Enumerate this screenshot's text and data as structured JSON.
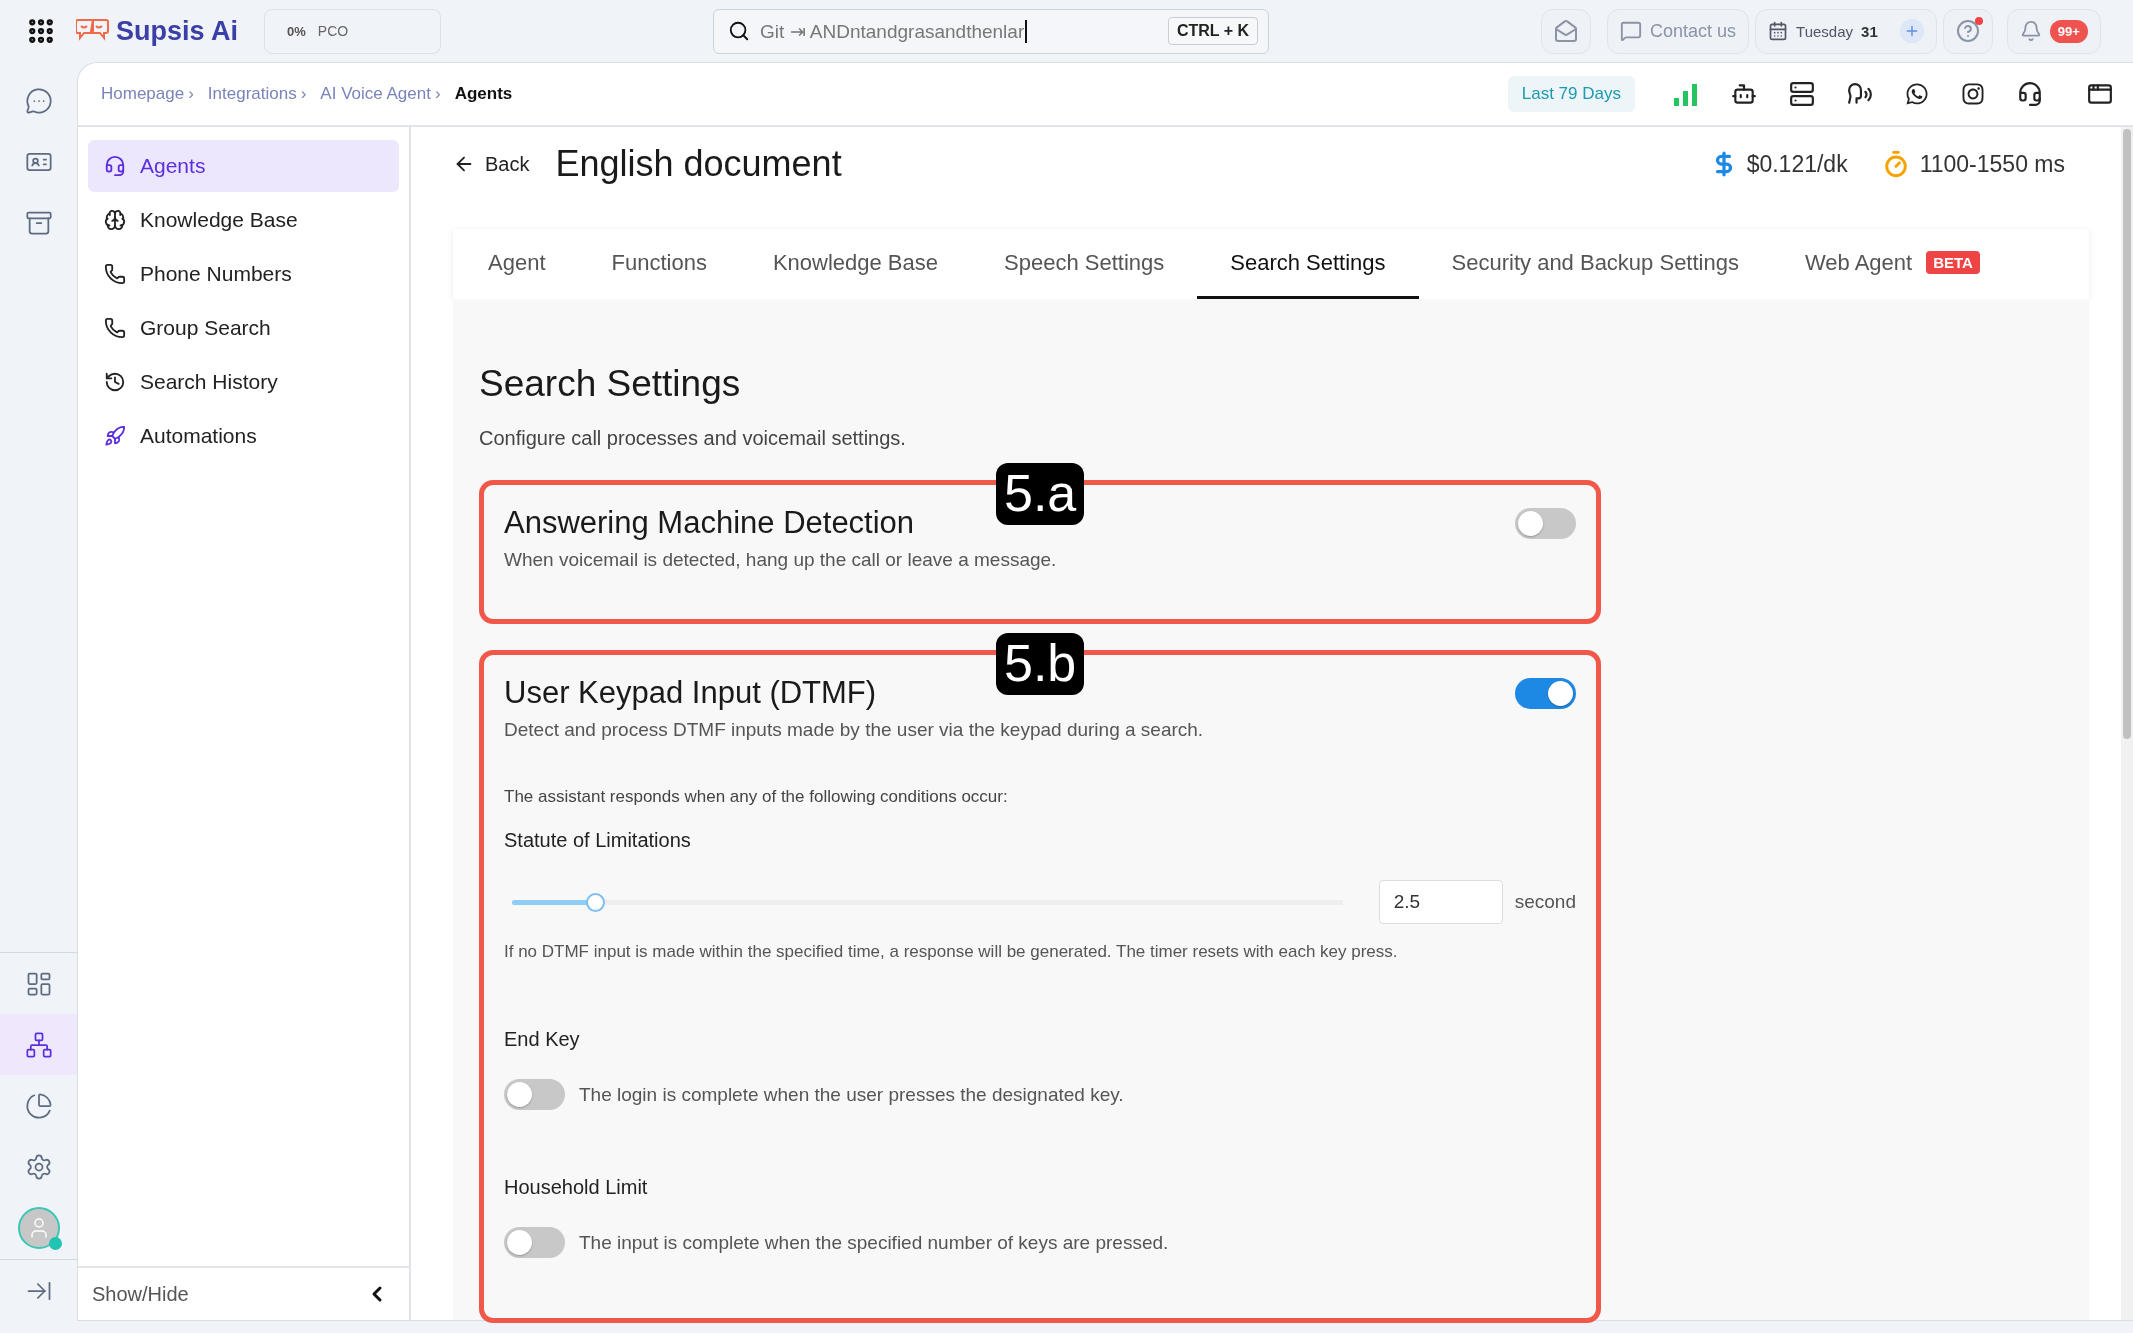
{
  "topbar": {
    "logo": "Supsis Ai",
    "progress": {
      "percent": "0%",
      "label": "PCO"
    },
    "search": {
      "value": "Git ⇥ ANDntandgrasandthenlar",
      "shortcut": "CTRL + K"
    },
    "contact": "Contact us",
    "date": {
      "day": "Tuesday",
      "number": "31"
    },
    "help": {
      "unread": true
    },
    "notifications": {
      "badge": "99+"
    }
  },
  "rail": {
    "items": [
      {
        "selected": false
      },
      {
        "selected": false
      },
      {
        "selected": false
      },
      {
        "selected": false
      },
      {
        "selected": true
      },
      {
        "selected": false
      },
      {
        "selected": false
      }
    ],
    "avatar": {
      "online": true
    }
  },
  "breadcrumb": [
    {
      "label": "Homepage",
      "current": false,
      "separator": "›"
    },
    {
      "label": "Integrations",
      "current": false,
      "separator": "›"
    },
    {
      "label": "AI Voice Agent",
      "current": false,
      "separator": "›"
    },
    {
      "label": "Agents",
      "current": true
    }
  ],
  "toolbar": {
    "range": "Last 79 Days"
  },
  "sidebar": {
    "items": [
      {
        "label": "Agents",
        "selected": true
      },
      {
        "label": "Knowledge Base",
        "selected": false
      },
      {
        "label": "Phone Numbers",
        "selected": false
      },
      {
        "label": "Group Search",
        "selected": false
      },
      {
        "label": "Search History",
        "selected": false
      },
      {
        "label": "Automations",
        "selected": false
      }
    ],
    "footer": "Show/Hide"
  },
  "header": {
    "back": "Back",
    "title": "English document",
    "price": "$0.121/dk",
    "latency": "1100-1550 ms"
  },
  "tabs": [
    {
      "label": "Agent",
      "selected": false
    },
    {
      "label": "Functions",
      "selected": false
    },
    {
      "label": "Knowledge Base",
      "selected": false
    },
    {
      "label": "Speech Settings",
      "selected": false
    },
    {
      "label": "Search Settings",
      "selected": true
    },
    {
      "label": "Security and Backup Settings",
      "selected": false
    },
    {
      "label": "Web Agent",
      "selected": false,
      "badge": "BETA"
    }
  ],
  "panel": {
    "title": "Search Settings",
    "subtitle": "Configure call processes and voicemail settings.",
    "sections": [
      {
        "marker": "5.a",
        "title": "Answering Machine Detection",
        "description": "When voicemail is detected, hang up the call or leave a message.",
        "on": false
      },
      {
        "marker": "5.b",
        "title": "User Keypad Input (DTMF)",
        "description": "Detect and process DTMF inputs made by the user via the keypad during a search.",
        "on": true,
        "note": "The assistant responds when any of the following conditions occur:",
        "settings": [
          {
            "kind": "slider",
            "label": "Statute of Limitations",
            "level": 0.1,
            "value": "2.5",
            "unit": "second",
            "help": "If no DTMF input is made within the specified time, a response will be generated. The timer resets with each key press."
          },
          {
            "kind": "toggle",
            "label": "End Key",
            "on": false,
            "description": "The login is complete when the user presses the designated key."
          },
          {
            "kind": "toggle",
            "label": "Household Limit",
            "on": false,
            "description": "The input is complete when the specified number of keys are pressed."
          }
        ]
      }
    ]
  }
}
